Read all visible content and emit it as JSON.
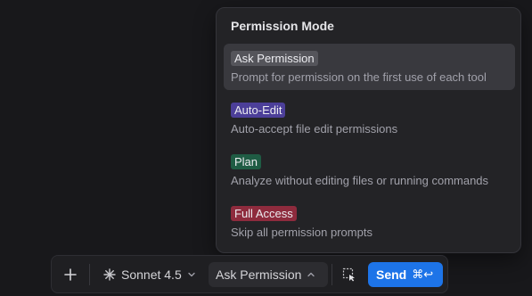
{
  "popover": {
    "title": "Permission Mode",
    "selected_index": 0,
    "options": [
      {
        "label": "Ask Permission",
        "description": "Prompt for permission on the first use of each tool",
        "badge_color": "#55555b"
      },
      {
        "label": "Auto-Edit",
        "description": "Auto-accept file edit permissions",
        "badge_color": "#4c3f99"
      },
      {
        "label": "Plan",
        "description": "Analyze without editing files or running commands",
        "badge_color": "#1f5c44"
      },
      {
        "label": "Full Access",
        "description": "Skip all permission prompts",
        "badge_color": "#8e2b3d"
      }
    ]
  },
  "toolbar": {
    "add_icon": "plus-icon",
    "model_label": "Sonnet 4.5",
    "model_icon": "sparkle-icon",
    "permission_label": "Ask Permission",
    "select_icon": "selection-cursor-icon",
    "send_label": "Send",
    "send_shortcut": "⌘↩",
    "send_color": "#1d74e8"
  }
}
